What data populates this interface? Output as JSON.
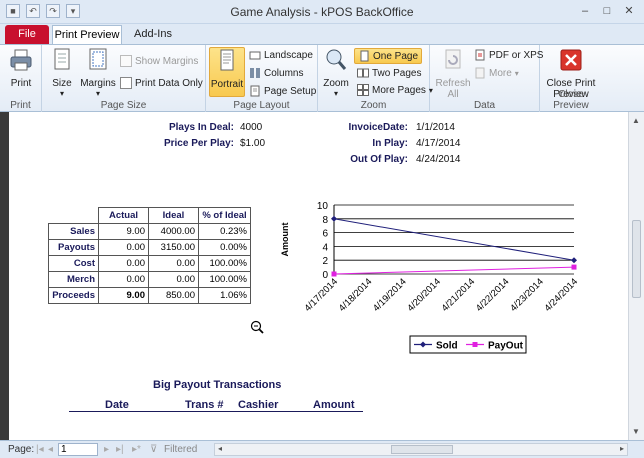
{
  "window": {
    "title": "Game Analysis - kPOS BackOffice",
    "controls": [
      "–",
      "□",
      "✕"
    ]
  },
  "tabs": {
    "file": "File",
    "print_preview": "Print Preview",
    "addins": "Add-Ins"
  },
  "ribbon": {
    "print": {
      "print": "Print",
      "group": "Print"
    },
    "page_size": {
      "size": "Size",
      "margins": "Margins",
      "show_margins": "Show Margins",
      "print_data_only": "Print Data Only",
      "group": "Page Size"
    },
    "page_layout": {
      "portrait": "Portrait",
      "landscape": "Landscape",
      "columns": "Columns",
      "page_setup": "Page Setup",
      "group": "Page Layout"
    },
    "zoom": {
      "zoom": "Zoom",
      "one_page": "One Page",
      "two_pages": "Two Pages",
      "more_pages": "More Pages",
      "group": "Zoom"
    },
    "data": {
      "refresh_all_1": "Refresh",
      "refresh_all_2": "All",
      "pdf_xps": "PDF or XPS",
      "more": "More",
      "group": "Data"
    },
    "close": {
      "close_1": "Close Print",
      "close_2": "Preview",
      "group": "Close Preview"
    }
  },
  "report": {
    "plays_in_deal_label": "Plays In Deal:",
    "plays_in_deal": "4000",
    "price_per_play_label": "Price Per Play:",
    "price_per_play": "$1.00",
    "invoice_date_label": "InvoiceDate:",
    "invoice_date": "1/1/2014",
    "in_play_label": "In Play:",
    "in_play": "4/17/2014",
    "out_of_play_label": "Out Of Play:",
    "out_of_play": "4/24/2014",
    "table": {
      "headers": [
        "Actual",
        "Ideal",
        "% of Ideal"
      ],
      "rows": [
        {
          "label": "Sales",
          "actual": "9.00",
          "ideal": "4000.00",
          "pct": "0.23%"
        },
        {
          "label": "Payouts",
          "actual": "0.00",
          "ideal": "3150.00",
          "pct": "0.00%"
        },
        {
          "label": "Cost",
          "actual": "0.00",
          "ideal": "0.00",
          "pct": "100.00%"
        },
        {
          "label": "Merch",
          "actual": "0.00",
          "ideal": "0.00",
          "pct": "100.00%"
        },
        {
          "label": "Proceeds",
          "actual": "9.00",
          "ideal": "850.00",
          "pct": "1.06%"
        }
      ]
    },
    "big_payout_title": "Big Payout Transactions",
    "big_payout_columns": [
      "Date",
      "Trans #",
      "Cashier",
      "Amount"
    ]
  },
  "chart_data": {
    "type": "line",
    "categories": [
      "4/17/2014",
      "4/18/2014",
      "4/19/2014",
      "4/20/2014",
      "4/21/2014",
      "4/22/2014",
      "4/23/2014",
      "4/24/2014"
    ],
    "x": [
      "4/17/2014",
      "4/24/2014"
    ],
    "series": [
      {
        "name": "Sold",
        "values": [
          8,
          2
        ],
        "color": "#1f1f7a",
        "marker": "diamond"
      },
      {
        "name": "PayOut",
        "values": [
          0,
          1
        ],
        "color": "#e020e0",
        "marker": "square"
      }
    ],
    "ylabel": "Amount",
    "ylim": [
      0,
      10
    ],
    "yticks": [
      0,
      2,
      4,
      6,
      8,
      10
    ],
    "grid": true,
    "legend": "bottom"
  },
  "status": {
    "page_label": "Page:",
    "page_value": "1",
    "filtered": "Filtered"
  }
}
